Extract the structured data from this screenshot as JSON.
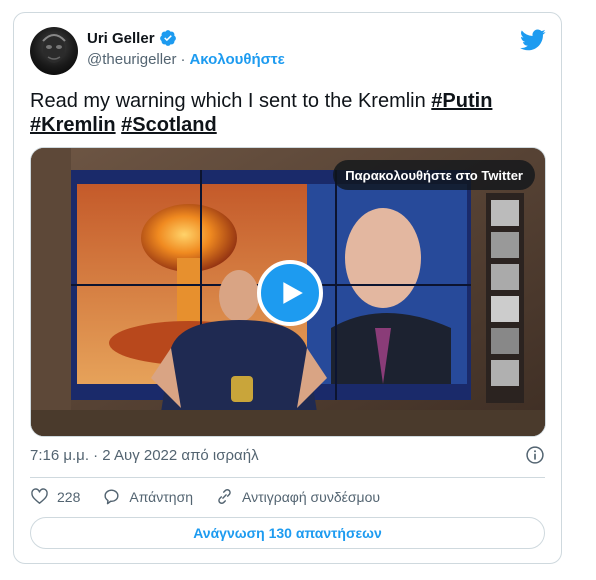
{
  "user": {
    "display_name": "Uri Geller",
    "handle": "@theurigeller",
    "separator": "·",
    "follow_label": "Ακολουθήστε"
  },
  "tweet": {
    "text_before": "Read my warning which I sent to the Kremlin ",
    "hashtags": [
      "#Putin",
      "#Kremlin",
      "#Scotland"
    ]
  },
  "media": {
    "watch_label": "Παρακολουθήστε στο Twitter"
  },
  "meta": {
    "timestamp": "7:16 μ.μ. · 2 Αυγ 2022 από ισραήλ"
  },
  "actions": {
    "likes_count": "228",
    "reply_label": "Απάντηση",
    "copy_link_label": "Αντιγραφή συνδέσμου"
  },
  "replies_button_label": "Ανάγνωση 130 απαντήσεων",
  "colors": {
    "accent": "#1d9bf0",
    "text": "#0f1419",
    "secondary": "#536471",
    "border": "#cfd9de"
  },
  "icons": [
    "verified-badge-icon",
    "twitter-bird-icon",
    "play-icon",
    "info-icon",
    "heart-icon",
    "reply-icon",
    "link-icon"
  ]
}
